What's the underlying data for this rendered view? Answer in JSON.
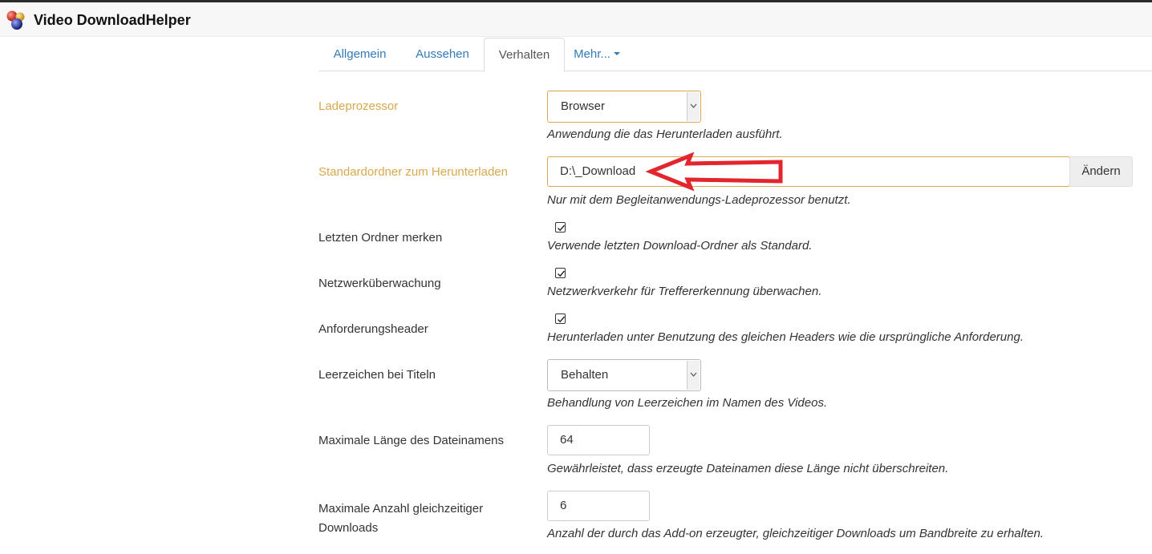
{
  "app": {
    "title": "Video DownloadHelper",
    "logo_icon": "three-spheres-logo"
  },
  "tabs": [
    {
      "label": "Allgemein",
      "active": false
    },
    {
      "label": "Aussehen",
      "active": false
    },
    {
      "label": "Verhalten",
      "active": true
    },
    {
      "label": "Mehr...",
      "active": false,
      "dropdown": true
    }
  ],
  "settings": {
    "ladeprozessor": {
      "label": "Ladeprozessor",
      "value": "Browser",
      "help": "Anwendung die das Herunterladen ausführt."
    },
    "standardordner": {
      "label": "Standardordner zum Herunterladen",
      "value": "D:\\_Download",
      "button": "Ändern",
      "help": "Nur mit dem Begleitanwendungs-Ladeprozessor benutzt."
    },
    "letzter_ordner": {
      "label": "Letzten Ordner merken",
      "checked": true,
      "help": "Verwende letzten Download-Ordner als Standard."
    },
    "netzwerk": {
      "label": "Netzwerküberwachung",
      "checked": true,
      "help": "Netzwerkverkehr für Treffererkennung überwachen."
    },
    "header": {
      "label": "Anforderungsheader",
      "checked": true,
      "help": "Herunterladen unter Benutzung des gleichen Headers wie die ursprüngliche Anforderung."
    },
    "leerzeichen": {
      "label": "Leerzeichen bei Titeln",
      "value": "Behalten",
      "help": "Behandlung von Leerzeichen im Namen des Videos."
    },
    "max_laenge": {
      "label": "Maximale Länge des Dateinamens",
      "value": "64",
      "help": "Gewährleistet, dass erzeugte Dateinamen diese Länge nicht überschreiten."
    },
    "max_downloads": {
      "label_line1": "Maximale Anzahl gleichzeitiger",
      "label_line2": "Downloads",
      "value": "6",
      "help": "Anzahl der durch das Add-on erzeugter, gleichzeitiger Downloads um Bandbreite zu erhalten."
    }
  },
  "colors": {
    "link": "#337ab7",
    "warning_label": "#d9a84e",
    "annotation_arrow": "#e3262e"
  }
}
